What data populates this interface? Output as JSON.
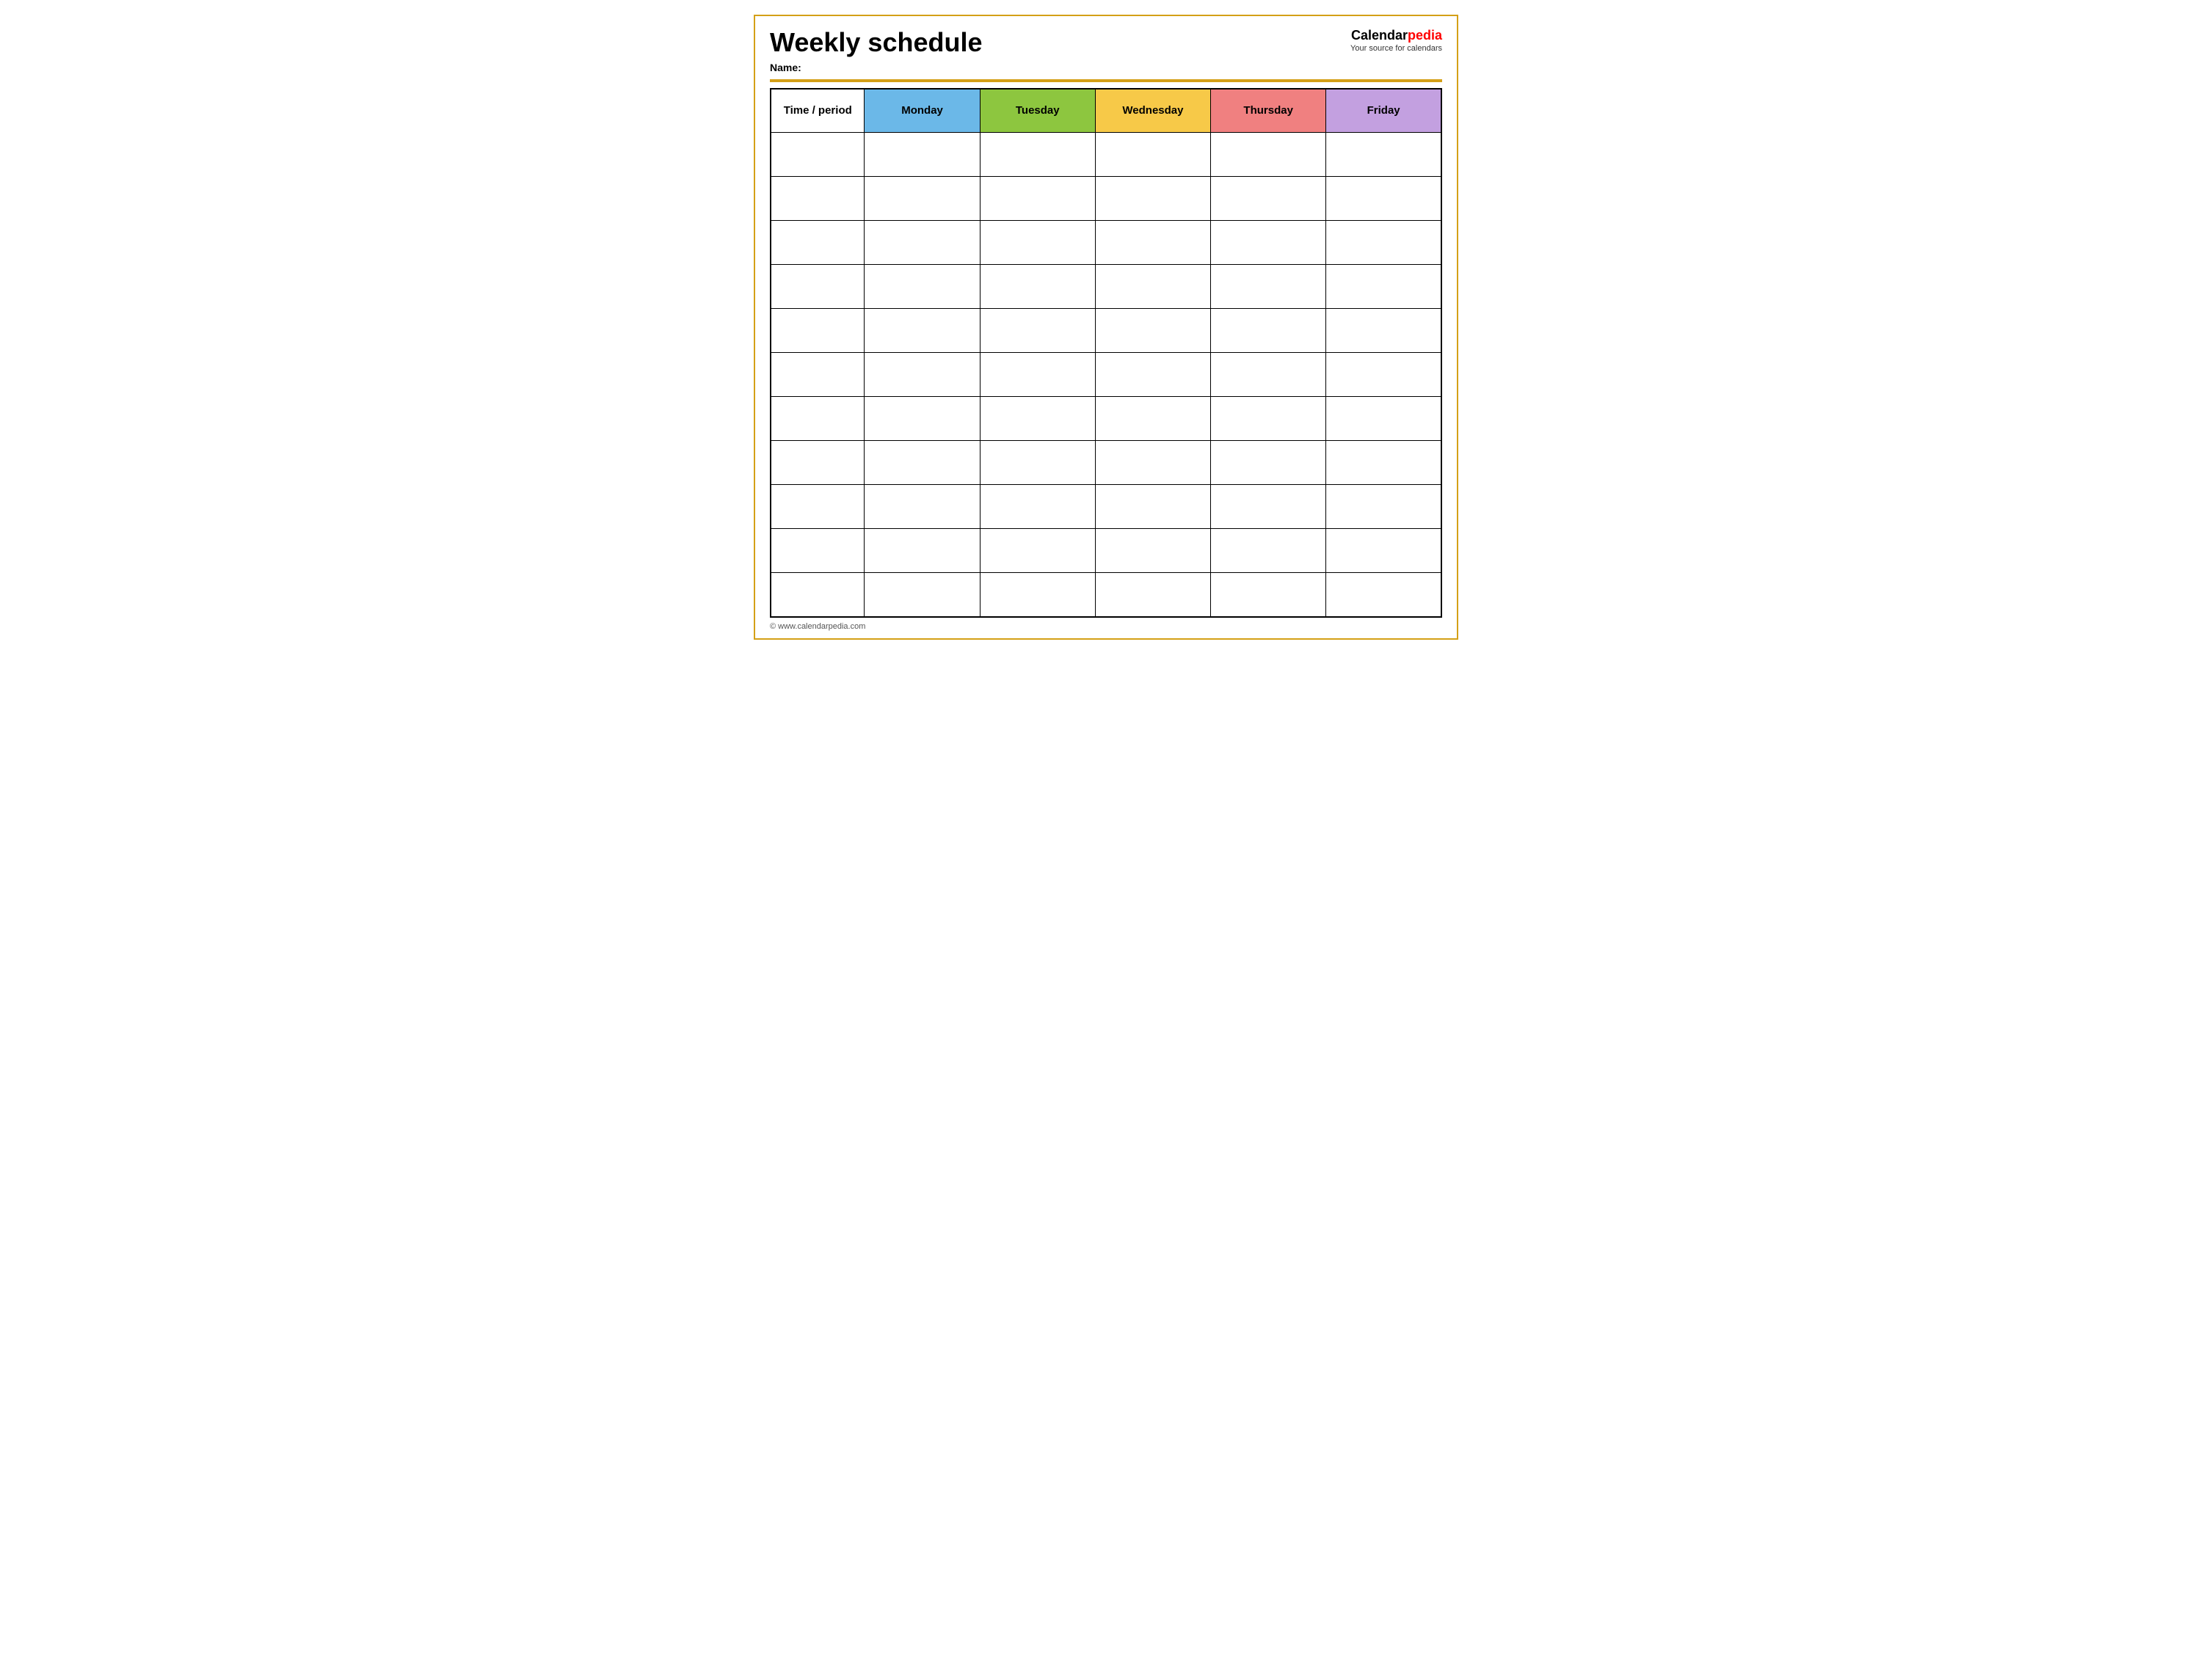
{
  "header": {
    "title": "Weekly schedule",
    "name_label": "Name:",
    "logo_brand": "Calendar",
    "logo_pedia": "pedia",
    "logo_tagline": "Your source for calendars"
  },
  "table": {
    "columns": [
      {
        "label": "Time / period",
        "class": "col-time"
      },
      {
        "label": "Monday",
        "class": "col-monday"
      },
      {
        "label": "Tuesday",
        "class": "col-tuesday"
      },
      {
        "label": "Wednesday",
        "class": "col-wednesday"
      },
      {
        "label": "Thursday",
        "class": "col-thursday"
      },
      {
        "label": "Friday",
        "class": "col-friday"
      }
    ],
    "row_count": 11
  },
  "footer": {
    "url": "© www.calendarpedia.com"
  }
}
